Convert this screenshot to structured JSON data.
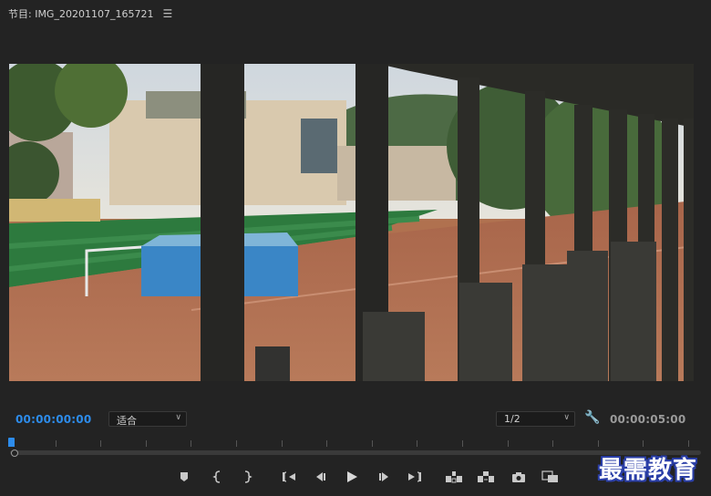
{
  "panel": {
    "title": "节目: IMG_20201107_165721",
    "menu_icon": "hamburger-menu-icon"
  },
  "timecode": {
    "current": "00:00:00:00",
    "duration": "00:00:05:00"
  },
  "zoom_dropdown": {
    "selected": "适合"
  },
  "resolution_dropdown": {
    "selected": "1/2"
  },
  "playhead": {
    "position_fraction": 0.0
  },
  "transport": {
    "buttons": [
      {
        "name": "add-marker-button",
        "icon": "marker-icon"
      },
      {
        "name": "mark-in-button",
        "icon": "mark-in-icon"
      },
      {
        "name": "mark-out-button",
        "icon": "mark-out-icon"
      },
      {
        "name": "go-to-in-button",
        "icon": "go-to-in-icon"
      },
      {
        "name": "step-back-button",
        "icon": "step-back-icon"
      },
      {
        "name": "play-button",
        "icon": "play-icon"
      },
      {
        "name": "step-forward-button",
        "icon": "step-forward-icon"
      },
      {
        "name": "go-to-out-button",
        "icon": "go-to-out-icon"
      },
      {
        "name": "lift-button",
        "icon": "lift-icon"
      },
      {
        "name": "extract-button",
        "icon": "extract-icon"
      },
      {
        "name": "export-frame-button",
        "icon": "camera-icon"
      },
      {
        "name": "comparison-view-button",
        "icon": "comparison-icon"
      }
    ]
  },
  "watermark": {
    "text": "最需教育"
  },
  "colors": {
    "panel_bg": "#232323",
    "timecode_active": "#2d8ceb",
    "timecode_inactive": "#9a9a9a",
    "watermark_outline": "#2b3fa8"
  }
}
